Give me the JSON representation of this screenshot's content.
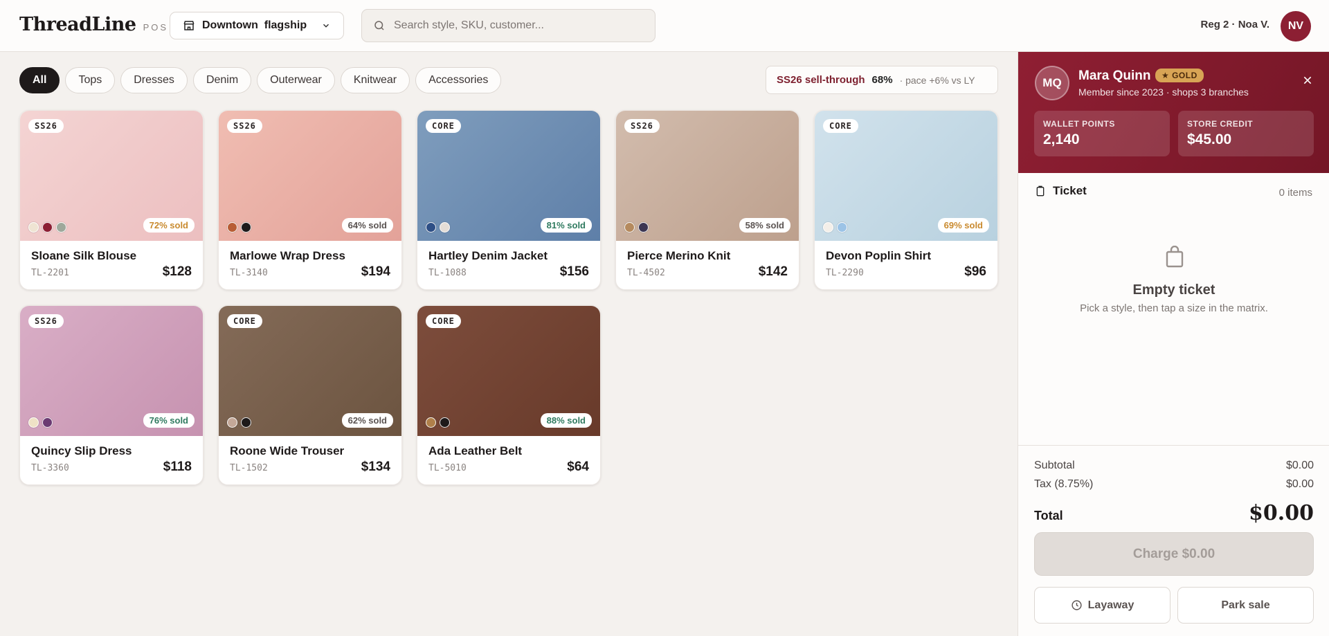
{
  "header": {
    "brand": "ThreadLine",
    "brand_sub": "POS",
    "store": "Downtown  flagship",
    "search_placeholder": "Search style, SKU, customer...",
    "register": "Reg 2 · Noa V.",
    "user_initials": "NV"
  },
  "filters": [
    "All",
    "Tops",
    "Dresses",
    "Denim",
    "Outerwear",
    "Knitwear",
    "Accessories"
  ],
  "active_filter": "All",
  "sellthrough": {
    "label": "SS26 sell-through",
    "percent": "68%",
    "pace": "· pace +6% vs LY"
  },
  "products": [
    {
      "tag": "SS26",
      "name": "Sloane Silk Blouse",
      "sku": "TL-2201",
      "price": "$128",
      "sold": "72% sold",
      "sold_color": "#c98a2e",
      "bg": [
        "#f4d4d3",
        "#ecbfc0"
      ],
      "swatches": [
        "#efe4d3",
        "#8c1f33",
        "#9ea89b"
      ]
    },
    {
      "tag": "SS26",
      "name": "Marlowe Wrap Dress",
      "sku": "TL-3140",
      "price": "$194",
      "sold": "64% sold",
      "sold_color": "#5a5351",
      "bg": [
        "#f0bdb2",
        "#e3a299"
      ],
      "swatches": [
        "#b85d35",
        "#1e1a1a"
      ]
    },
    {
      "tag": "CORE",
      "name": "Hartley Denim Jacket",
      "sku": "TL-1088",
      "price": "$156",
      "sold": "81% sold",
      "sold_color": "#2f7a5f",
      "bg": [
        "#7f9dbd",
        "#5e7fa8"
      ],
      "swatches": [
        "#2e4f86",
        "#e4ddd6"
      ]
    },
    {
      "tag": "SS26",
      "name": "Pierce Merino Knit",
      "sku": "TL-4502",
      "price": "$142",
      "sold": "58% sold",
      "sold_color": "#5a5351",
      "bg": [
        "#d2bcad",
        "#bda08d"
      ],
      "swatches": [
        "#b58a5e",
        "#3b3552"
      ]
    },
    {
      "tag": "CORE",
      "name": "Devon Poplin Shirt",
      "sku": "TL-2290",
      "price": "$96",
      "sold": "69% sold",
      "sold_color": "#c98a2e",
      "bg": [
        "#d1e2ec",
        "#b8d1df"
      ],
      "swatches": [
        "#f4efe9",
        "#9cc3e6"
      ]
    },
    {
      "tag": "SS26",
      "name": "Quincy Slip Dress",
      "sku": "TL-3360",
      "price": "$118",
      "sold": "76% sold",
      "sold_color": "#2f7a5f",
      "bg": [
        "#d9aec6",
        "#c692b0"
      ],
      "swatches": [
        "#efe2c6",
        "#6b3a72"
      ]
    },
    {
      "tag": "CORE",
      "name": "Roone Wide Trouser",
      "sku": "TL-1502",
      "price": "$134",
      "sold": "62% sold",
      "sold_color": "#5a5351",
      "bg": [
        "#846b58",
        "#6c5440"
      ],
      "swatches": [
        "#c4a898",
        "#1e1a1a"
      ]
    },
    {
      "tag": "CORE",
      "name": "Ada Leather Belt",
      "sku": "TL-5010",
      "price": "$64",
      "sold": "88% sold",
      "sold_color": "#2f7a5f",
      "bg": [
        "#7d4d3c",
        "#683a2a"
      ],
      "swatches": [
        "#b0804a",
        "#1e1a1a"
      ]
    }
  ],
  "member": {
    "initials": "MQ",
    "name": "Mara Quinn",
    "tier": "★ GOLD",
    "since": "Member since 2023 · shops 3 branches",
    "wallet_label": "WALLET POINTS",
    "wallet_value": "2,140",
    "credit_label": "STORE CREDIT",
    "credit_value": "$45.00"
  },
  "ticket": {
    "title": "Ticket",
    "count": "0 items",
    "empty_title": "Empty ticket",
    "empty_sub": "Pick a style, then tap a size in the matrix."
  },
  "totals": {
    "subtotal_label": "Subtotal",
    "subtotal": "$0.00",
    "tax_label": "Tax (8.75%)",
    "tax": "$0.00",
    "total_label": "Total",
    "total": "$0.00",
    "charge_label": "Charge $0.00",
    "layaway_label": "Layaway",
    "park_label": "Park sale"
  }
}
